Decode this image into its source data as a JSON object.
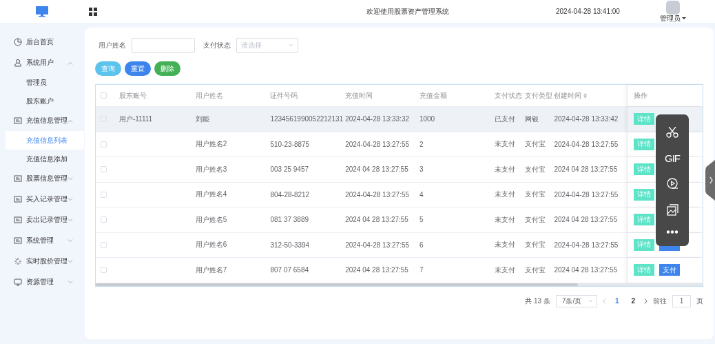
{
  "header": {
    "title": "欢迎使用股票资产管理系统",
    "datetime": "2024-04-28 13:41:00",
    "user": "管理员"
  },
  "sidebar": {
    "items": [
      {
        "label": "后台首页",
        "selected": false
      },
      {
        "label": "系统用户",
        "selected": false,
        "expanded": true,
        "children": [
          {
            "label": "管理员",
            "selected": false
          },
          {
            "label": "股东账户",
            "selected": false
          }
        ]
      },
      {
        "label": "充值信息管理",
        "selected": false,
        "expanded": true,
        "children": [
          {
            "label": "充值信息列表",
            "selected": true
          },
          {
            "label": "充值信息添加",
            "selected": false
          }
        ]
      },
      {
        "label": "股票信息管理",
        "selected": false,
        "expanded": false
      },
      {
        "label": "买入记录管理",
        "selected": false,
        "expanded": false
      },
      {
        "label": "卖出记录管理",
        "selected": false,
        "expanded": false
      },
      {
        "label": "系统管理",
        "selected": false,
        "expanded": false
      },
      {
        "label": "实时股价管理",
        "selected": false,
        "expanded": false
      },
      {
        "label": "资源管理",
        "selected": false,
        "expanded": false
      }
    ]
  },
  "search": {
    "fields": [
      {
        "kind": "text",
        "label": "用户姓名"
      },
      {
        "kind": "select",
        "label": "支付状态",
        "placeholder": "请选择"
      }
    ],
    "buttons": [
      {
        "label": "查询",
        "color": "#5bc3ec"
      },
      {
        "label": "重置",
        "color": "#3d85ec"
      },
      {
        "label": "删除",
        "color": "#45b157"
      }
    ]
  },
  "table": {
    "select_all": false,
    "columns": [
      {
        "label": "股东账号",
        "sortable": false
      },
      {
        "label": "用户姓名",
        "sortable": false
      },
      {
        "label": "证件号码",
        "sortable": false
      },
      {
        "label": "充值时间",
        "sortable": false
      },
      {
        "label": "充值金额",
        "sortable": false
      },
      {
        "label": "支付状态",
        "sortable": false
      },
      {
        "label": "支付类型",
        "sortable": false
      },
      {
        "label": "创建时间",
        "sortable": true
      },
      {
        "label": "操作",
        "sortable": false
      }
    ],
    "rows": [
      {
        "checked": false,
        "hovered": true,
        "cells": [
          "用户-11111",
          "刘能",
          "1234561990052212131",
          "2024-04-28 13:33:32",
          "1000",
          "已支付",
          "网银",
          "2024-04-28 13:33:42"
        ],
        "actions": [
          {
            "kind": "detail",
            "label": "详情"
          }
        ]
      },
      {
        "checked": false,
        "hovered": false,
        "cells": [
          "",
          "用户姓名2",
          "510-23-8875",
          "2024-04-28 13:27:55",
          "2",
          "未支付",
          "支付宝",
          "2024-04-28 13:27:55"
        ],
        "actions": [
          {
            "kind": "detail",
            "label": "详情"
          }
        ]
      },
      {
        "checked": false,
        "hovered": false,
        "cells": [
          "",
          "用户姓名3",
          "003 25 9457",
          "2024 04 28 13:27:55",
          "3",
          "未支付",
          "支付宝",
          "2024 04 28 13:27:55"
        ],
        "actions": [
          {
            "kind": "detail",
            "label": "详情"
          }
        ]
      },
      {
        "checked": false,
        "hovered": false,
        "cells": [
          "",
          "用户姓名4",
          "804-28-8212",
          "2024-04-28 13:27:55",
          "4",
          "未支付",
          "支付宝",
          "2024-04-28 13:27:55"
        ],
        "actions": [
          {
            "kind": "detail",
            "label": "详情"
          }
        ]
      },
      {
        "checked": false,
        "hovered": false,
        "cells": [
          "",
          "用户姓名5",
          "081 37 3889",
          "2024 04 28 13:27:55",
          "5",
          "未支付",
          "支付宝",
          "2024 04 28 13:27:55"
        ],
        "actions": [
          {
            "kind": "detail",
            "label": "详情"
          }
        ]
      },
      {
        "checked": false,
        "hovered": false,
        "cells": [
          "",
          "用户姓名6",
          "312-50-3394",
          "2024-04-28 13:27:55",
          "6",
          "未支付",
          "支付宝",
          "2024-04-28 13:27:55"
        ],
        "actions": [
          {
            "kind": "detail",
            "label": "详情"
          },
          {
            "kind": "pay"
          }
        ]
      },
      {
        "checked": false,
        "hovered": false,
        "cells": [
          "",
          "用户姓名7",
          "807 07 6584",
          "2024 04 28 13:27:55",
          "7",
          "未支付",
          "支付宝",
          "2024 04 28 13:27:55"
        ],
        "actions": [
          {
            "kind": "detail",
            "label": "详情"
          },
          {
            "kind": "pay",
            "label": "支付"
          }
        ]
      }
    ]
  },
  "pagination": {
    "total": "共 13 条",
    "page_size": "7条/页",
    "pages": [
      {
        "label": "1",
        "selected": true
      },
      {
        "label": "2",
        "selected": false
      }
    ],
    "goto_label": "前往",
    "goto_value": "1",
    "goto_suffix": "页"
  },
  "capture_toolbar": {
    "items": [
      {
        "kind": "scissors"
      },
      {
        "kind": "gif",
        "label": "GIF"
      },
      {
        "kind": "record"
      },
      {
        "kind": "image"
      },
      {
        "kind": "more"
      }
    ]
  }
}
